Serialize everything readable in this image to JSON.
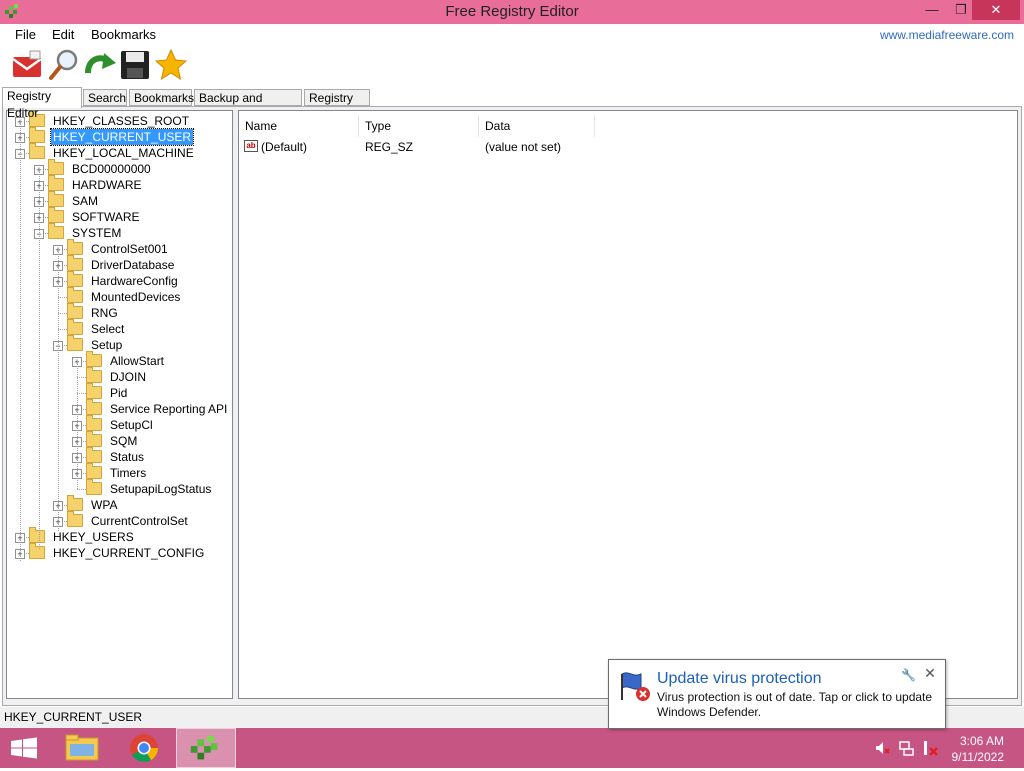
{
  "window": {
    "title": "Free Registry Editor",
    "minimize_symbol": "—",
    "maximize_symbol": "❐",
    "close_symbol": "✕"
  },
  "menu": {
    "items": [
      "File",
      "Edit",
      "Bookmarks"
    ],
    "website": "www.mediafreeware.com"
  },
  "toolbar": {
    "icons": [
      "mail-icon",
      "search-magnifier-icon",
      "refresh-arrow-icon",
      "save-floppy-icon",
      "bookmark-star-icon"
    ]
  },
  "tabs": [
    "Registry Editor",
    "Search",
    "Bookmarks",
    "Backup and Restore",
    "Registry Diff"
  ],
  "tree": {
    "nodes": [
      {
        "label": "HKEY_CLASSES_ROOT",
        "expander": "+"
      },
      {
        "label": "HKEY_CURRENT_USER",
        "expander": "+"
      },
      {
        "label": "HKEY_LOCAL_MACHINE",
        "expander": "−"
      },
      {
        "label": "BCD00000000",
        "expander": "+"
      },
      {
        "label": "HARDWARE",
        "expander": "+"
      },
      {
        "label": "SAM",
        "expander": "+"
      },
      {
        "label": "SOFTWARE",
        "expander": "+"
      },
      {
        "label": "SYSTEM",
        "expander": "−"
      },
      {
        "label": "ControlSet001",
        "expander": "+"
      },
      {
        "label": "DriverDatabase",
        "expander": "+"
      },
      {
        "label": "HardwareConfig",
        "expander": "+"
      },
      {
        "label": "MountedDevices",
        "expander": ""
      },
      {
        "label": "RNG",
        "expander": ""
      },
      {
        "label": "Select",
        "expander": ""
      },
      {
        "label": "Setup",
        "expander": "−"
      },
      {
        "label": "AllowStart",
        "expander": "+"
      },
      {
        "label": "DJOIN",
        "expander": ""
      },
      {
        "label": "Pid",
        "expander": ""
      },
      {
        "label": "Service Reporting API",
        "expander": "+"
      },
      {
        "label": "SetupCl",
        "expander": "+"
      },
      {
        "label": "SQM",
        "expander": "+"
      },
      {
        "label": "Status",
        "expander": "+"
      },
      {
        "label": "Timers",
        "expander": "+"
      },
      {
        "label": "SetupapiLogStatus",
        "expander": ""
      },
      {
        "label": "WPA",
        "expander": "+"
      },
      {
        "label": "CurrentControlSet",
        "expander": "+"
      },
      {
        "label": "HKEY_USERS",
        "expander": "+"
      },
      {
        "label": "HKEY_CURRENT_CONFIG",
        "expander": "+"
      }
    ],
    "selected": "HKEY_CURRENT_USER"
  },
  "list": {
    "columns": [
      "Name",
      "Type",
      "Data"
    ],
    "rows": [
      {
        "name": "(Default)",
        "type": "REG_SZ",
        "data": "(value not set)",
        "icon_text": "ab"
      }
    ]
  },
  "status": "HKEY_CURRENT_USER",
  "taskbar": {
    "apps": [
      "windows-start-icon",
      "file-explorer-icon",
      "chrome-icon",
      "registry-editor-icon"
    ],
    "time": "3:06 AM",
    "date": "9/11/2022"
  },
  "notification": {
    "title": "Update virus protection",
    "body": "Virus protection is out of date. Tap or click to update Windows Defender.",
    "settings_symbol": "🔧",
    "close_symbol": "✕"
  },
  "colors": {
    "titlebar": "#e86e99",
    "close_button": "#c7355a",
    "taskbar": "#c65584",
    "selection": "#3399ff",
    "link": "#2e6bbf",
    "notification_title": "#1d5fb8"
  }
}
